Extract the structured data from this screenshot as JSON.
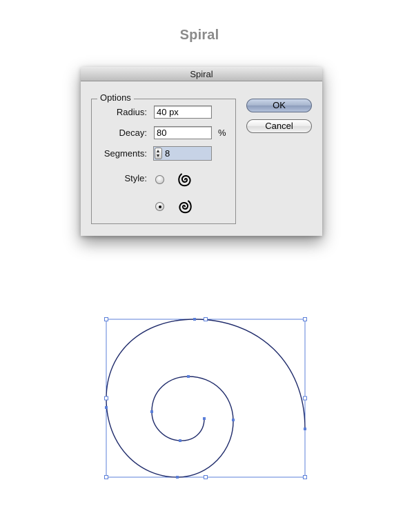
{
  "page": {
    "title": "Spiral"
  },
  "dialog": {
    "title": "Spiral",
    "options_legend": "Options",
    "radius": {
      "label": "Radius:",
      "value": "40 px"
    },
    "decay": {
      "label": "Decay:",
      "value": "80",
      "unit": "%"
    },
    "segments": {
      "label": "Segments:",
      "value": "8"
    },
    "style": {
      "label": "Style:",
      "options": [
        {
          "icon": "spiral-counterclockwise-icon",
          "selected": false
        },
        {
          "icon": "spiral-clockwise-icon",
          "selected": true
        }
      ]
    },
    "buttons": {
      "ok": "OK",
      "cancel": "Cancel"
    }
  },
  "accent_color": "#4a6fd6"
}
